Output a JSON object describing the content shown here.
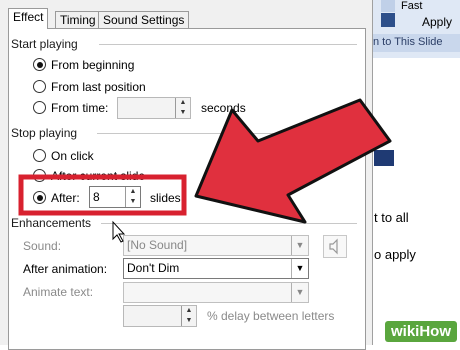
{
  "tabs": [
    {
      "label": "Effect",
      "active": true
    },
    {
      "label": "Timing",
      "active": false
    },
    {
      "label": "Sound Settings",
      "active": false
    }
  ],
  "start_playing": {
    "title": "Start playing",
    "options": [
      {
        "label": "From beginning",
        "checked": true
      },
      {
        "label": "From last position",
        "checked": false
      },
      {
        "label": "From time:",
        "checked": false
      }
    ],
    "time_value": "",
    "time_unit": "seconds"
  },
  "stop_playing": {
    "title": "Stop playing",
    "options": [
      {
        "label": "On click",
        "checked": false
      },
      {
        "label": "After current slide",
        "checked": false
      },
      {
        "label": "After:",
        "checked": true
      }
    ],
    "after_value": "8",
    "after_unit": "slides"
  },
  "enhancements": {
    "title": "Enhancements",
    "sound_label": "Sound:",
    "sound_value": "[No Sound]",
    "after_animation_label": "After animation:",
    "after_animation_value": "Don't Dim",
    "animate_text_label": "Animate text:",
    "animate_text_value": "",
    "delay_value": "",
    "delay_label": "% delay between letters"
  },
  "background_app": {
    "ribbon_fast": "Fast",
    "ribbon_apply": "Apply",
    "ribbon_to_this_slide": "n to This Slide",
    "text_all": "t to all",
    "text_apply": "o apply"
  },
  "watermark": "wikiHow",
  "colors": {
    "arrow_fill": "#e0303e",
    "highlight_box": "#d8212f",
    "accent_blue": "#1f3a73"
  }
}
